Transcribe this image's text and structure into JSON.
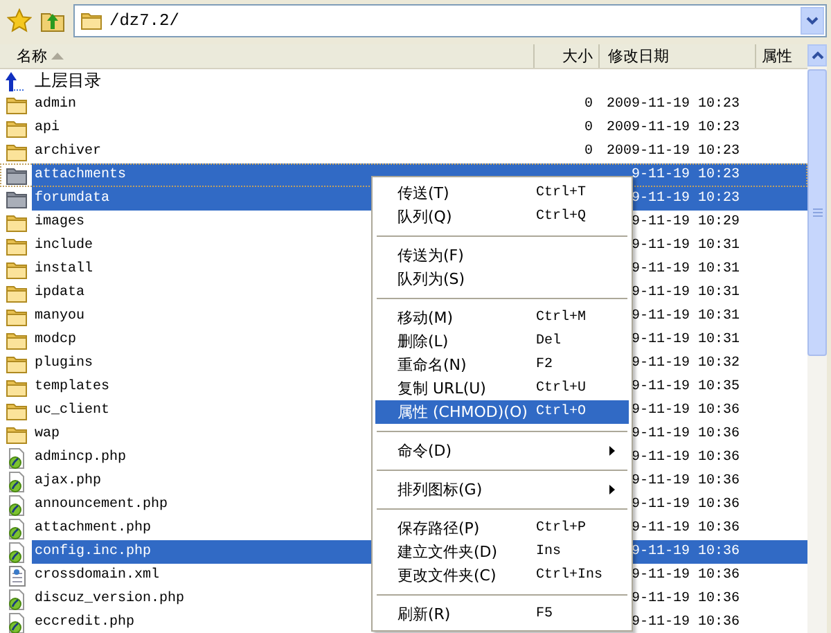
{
  "address_bar": {
    "value": "/dz7.2/"
  },
  "columns": [
    {
      "label": "名称",
      "sorted": true
    },
    {
      "label": "大小",
      "sorted": false
    },
    {
      "label": "修改日期",
      "sorted": false
    },
    {
      "label": "属性",
      "sorted": false
    }
  ],
  "rows": [
    {
      "kind": "up",
      "name": "上层目录",
      "selected": false
    },
    {
      "kind": "folder",
      "name": "admin",
      "size": "0",
      "date": "2009-11-19 10:23",
      "selected": false
    },
    {
      "kind": "folder",
      "name": "api",
      "size": "0",
      "date": "2009-11-19 10:23",
      "selected": false
    },
    {
      "kind": "folder",
      "name": "archiver",
      "size": "0",
      "date": "2009-11-19 10:23",
      "selected": false
    },
    {
      "kind": "folder",
      "name": "attachments",
      "date": "9-11-19 10:23",
      "selected": true
    },
    {
      "kind": "folder",
      "name": "forumdata",
      "date": "9-11-19 10:23",
      "selected": true
    },
    {
      "kind": "folder",
      "name": "images",
      "date": "9-11-19 10:29",
      "selected": false
    },
    {
      "kind": "folder",
      "name": "include",
      "date": "9-11-19 10:31",
      "selected": false
    },
    {
      "kind": "folder",
      "name": "install",
      "date": "9-11-19 10:31",
      "selected": false
    },
    {
      "kind": "folder",
      "name": "ipdata",
      "date": "9-11-19 10:31",
      "selected": false
    },
    {
      "kind": "folder",
      "name": "manyou",
      "date": "9-11-19 10:31",
      "selected": false
    },
    {
      "kind": "folder",
      "name": "modcp",
      "date": "9-11-19 10:31",
      "selected": false
    },
    {
      "kind": "folder",
      "name": "plugins",
      "date": "9-11-19 10:32",
      "selected": false
    },
    {
      "kind": "folder",
      "name": "templates",
      "date": "9-11-19 10:35",
      "selected": false
    },
    {
      "kind": "folder",
      "name": "uc_client",
      "date": "9-11-19 10:36",
      "selected": false
    },
    {
      "kind": "folder",
      "name": "wap",
      "date": "9-11-19 10:36",
      "selected": false
    },
    {
      "kind": "php",
      "name": "admincp.php",
      "date": "9-11-19 10:36",
      "selected": false
    },
    {
      "kind": "php",
      "name": "ajax.php",
      "date": "9-11-19 10:36",
      "selected": false
    },
    {
      "kind": "php",
      "name": "announcement.php",
      "date": "9-11-19 10:36",
      "selected": false
    },
    {
      "kind": "php",
      "name": "attachment.php",
      "date": "9-11-19 10:36",
      "selected": false
    },
    {
      "kind": "php",
      "name": "config.inc.php",
      "date": "9-11-19 10:36",
      "selected": true
    },
    {
      "kind": "xml",
      "name": "crossdomain.xml",
      "date": "9-11-19 10:36",
      "selected": false
    },
    {
      "kind": "php",
      "name": "discuz_version.php",
      "date": "9-11-19 10:36",
      "selected": false
    },
    {
      "kind": "php",
      "name": "eccredit.php",
      "date": "9-11-19 10:36",
      "selected": false
    }
  ],
  "context_menu": {
    "items": [
      {
        "kind": "item",
        "label": "传送(T)",
        "shortcut": "Ctrl+T",
        "selected": false
      },
      {
        "kind": "item",
        "label": "队列(Q)",
        "shortcut": "Ctrl+Q",
        "selected": false
      },
      {
        "kind": "separator"
      },
      {
        "kind": "item",
        "label": "传送为(F)",
        "selected": false
      },
      {
        "kind": "item",
        "label": "队列为(S)",
        "selected": false
      },
      {
        "kind": "separator"
      },
      {
        "kind": "item",
        "label": "移动(M)",
        "shortcut": "Ctrl+M",
        "selected": false
      },
      {
        "kind": "item",
        "label": "删除(L)",
        "shortcut": "Del",
        "selected": false
      },
      {
        "kind": "item",
        "label": "重命名(N)",
        "shortcut": "F2",
        "selected": false
      },
      {
        "kind": "item",
        "label": "复制 URL(U)",
        "shortcut": "Ctrl+U",
        "selected": false
      },
      {
        "kind": "item",
        "label": "属性 (CHMOD)(O)",
        "shortcut": "Ctrl+O",
        "selected": true
      },
      {
        "kind": "separator"
      },
      {
        "kind": "submenu",
        "label": "命令(D)",
        "selected": false
      },
      {
        "kind": "separator"
      },
      {
        "kind": "submenu",
        "label": "排列图标(G)",
        "selected": false
      },
      {
        "kind": "separator"
      },
      {
        "kind": "item",
        "label": "保存路径(P)",
        "shortcut": "Ctrl+P",
        "selected": false
      },
      {
        "kind": "item",
        "label": "建立文件夹(D)",
        "shortcut": "Ins",
        "selected": false
      },
      {
        "kind": "item",
        "label": "更改文件夹(C)",
        "shortcut": "Ctrl+Ins",
        "selected": false
      },
      {
        "kind": "separator"
      },
      {
        "kind": "item",
        "label": "刷新(R)",
        "shortcut": "F5",
        "selected": false
      }
    ]
  }
}
